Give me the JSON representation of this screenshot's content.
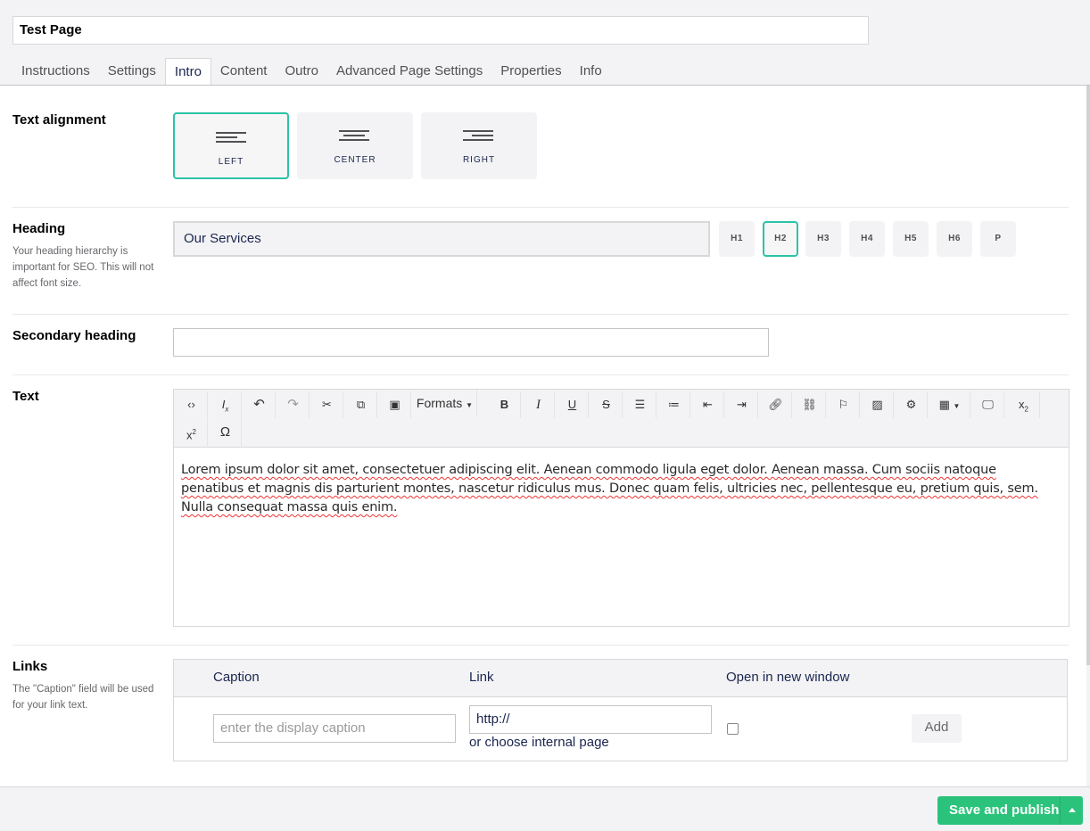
{
  "page": {
    "name": "Test Page"
  },
  "tabs": [
    {
      "label": "Instructions"
    },
    {
      "label": "Settings"
    },
    {
      "label": "Intro"
    },
    {
      "label": "Content"
    },
    {
      "label": "Outro"
    },
    {
      "label": "Advanced Page Settings"
    },
    {
      "label": "Properties"
    },
    {
      "label": "Info"
    }
  ],
  "active_tab": "Intro",
  "text_alignment": {
    "label": "Text alignment",
    "options": [
      {
        "label": "LEFT",
        "selected": true
      },
      {
        "label": "CENTER",
        "selected": false
      },
      {
        "label": "RIGHT",
        "selected": false
      }
    ]
  },
  "heading": {
    "label": "Heading",
    "description": "Your heading hierarchy is important for SEO. This will not affect font size.",
    "value": "Our Services",
    "levels": [
      "H1",
      "H2",
      "H3",
      "H4",
      "H5",
      "H6",
      "P"
    ],
    "selected_level": "H2"
  },
  "secondary_heading": {
    "label": "Secondary heading",
    "value": ""
  },
  "text": {
    "label": "Text",
    "toolbar": {
      "formats_label": "Formats",
      "icons": [
        "source-code-icon",
        "clear-format-icon",
        "undo-icon",
        "redo-icon",
        "cut-icon",
        "copy-icon",
        "paste-icon",
        "formats-dropdown",
        "bold-icon",
        "italic-icon",
        "underline-icon",
        "strikethrough-icon",
        "bullet-list-icon",
        "numbered-list-icon",
        "outdent-icon",
        "indent-icon",
        "link-icon",
        "unlink-icon",
        "anchor-icon",
        "image-icon",
        "macro-icon",
        "table-icon",
        "preview-icon",
        "subscript-icon",
        "superscript-icon",
        "special-char-icon"
      ]
    },
    "body": "Lorem ipsum dolor sit amet, consectetuer adipiscing elit. Aenean commodo ligula eget dolor. Aenean massa. Cum sociis natoque penatibus et magnis dis parturient montes, nascetur ridiculus mus. Donec quam felis, ultricies nec, pellentesque eu, pretium quis, sem. Nulla consequat massa quis enim."
  },
  "links": {
    "label": "Links",
    "description": "The \"Caption\" field will be used for your link text.",
    "columns": [
      "Caption",
      "Link",
      "Open in new window"
    ],
    "caption_placeholder": "enter the display caption",
    "link_value": "http://",
    "choose_internal": "or choose internal page",
    "open_new_window": false,
    "add_label": "Add"
  },
  "footer": {
    "save_label": "Save and publish"
  },
  "colors": {
    "accent": "#2bc3a7",
    "save": "#2bc37c",
    "text": "#1b264f"
  }
}
